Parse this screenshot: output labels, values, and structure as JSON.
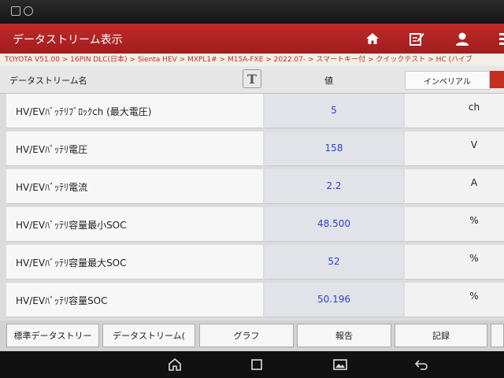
{
  "app": {
    "title": "データストリーム表示"
  },
  "breadcrumb": "TOYOTA V51.00 > 16PIN DLC(日本) > Sienta HEV > MXPL1# > M15A-FXE > 2022.07- > スマートキー付 > クイックテスト > HC (ハイブ",
  "header": {
    "name_col": "データストリーム名",
    "value_col": "値",
    "unit_toggle": "インペリアル"
  },
  "rows": [
    {
      "name": "HV/EVﾊﾞｯﾃﾘﾌﾞﾛｯｸch (最大電圧)",
      "value": "5",
      "unit": "ch"
    },
    {
      "name": "HV/EVﾊﾞｯﾃﾘ電圧",
      "value": "158",
      "unit": "V"
    },
    {
      "name": "HV/EVﾊﾞｯﾃﾘ電流",
      "value": "2.2",
      "unit": "A"
    },
    {
      "name": "HV/EVﾊﾞｯﾃﾘ容量最小SOC",
      "value": "48.500",
      "unit": "%"
    },
    {
      "name": "HV/EVﾊﾞｯﾃﾘ容量最大SOC",
      "value": "52",
      "unit": "%"
    },
    {
      "name": "HV/EVﾊﾞｯﾃﾘ容量SOC",
      "value": "50.196",
      "unit": "%"
    }
  ],
  "buttons": {
    "standard": "標準データストリー",
    "datastream": "データストリーム(",
    "graph": "グラフ",
    "report": "報告",
    "record": "記録"
  },
  "icons": [
    "home-icon",
    "edit-icon",
    "user-icon",
    "menu-icon",
    "android-home-icon",
    "android-recents-icon",
    "gallery-icon",
    "android-back-icon"
  ],
  "colors": {
    "title_bar": "#b02222",
    "breadcrumb_text": "#c0301e",
    "value_text": "#2d3fd8"
  }
}
